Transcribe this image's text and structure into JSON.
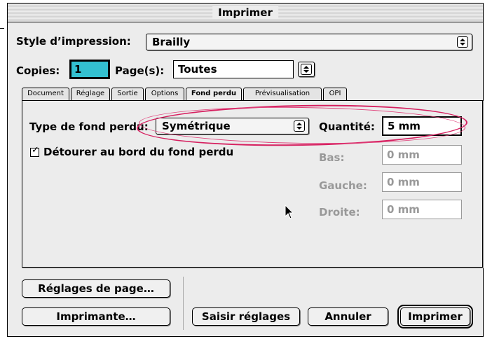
{
  "window": {
    "title": "Imprimer"
  },
  "print_style": {
    "label": "Style d’impression:",
    "value": "Brailly"
  },
  "copies": {
    "label": "Copies:",
    "value": "1"
  },
  "pages": {
    "label": "Page(s):",
    "value": "Toutes"
  },
  "tabs": [
    "Document",
    "Réglage",
    "Sortie",
    "Options",
    "Fond perdu",
    "Prévisualisation",
    "OPI"
  ],
  "active_tab": "Fond perdu",
  "bleed": {
    "type_label": "Type de fond perdu:",
    "type_value": "Symétrique",
    "quantity_label": "Quantité:",
    "quantity_value": "5 mm",
    "clip_label": "Détourer au bord du fond perdu",
    "clip_checked": true,
    "bottom_label": "Bas:",
    "bottom_value": "0 mm",
    "left_label": "Gauche:",
    "left_value": "0 mm",
    "right_label": "Droite:",
    "right_value": "0 mm"
  },
  "buttons": {
    "page_setup": "Réglages de page…",
    "printer": "Imprimante…",
    "capture": "Saisir réglages",
    "cancel": "Annuler",
    "print": "Imprimer"
  },
  "colors": {
    "highlight": "#d62060",
    "copies_field": "#33c0d0"
  }
}
